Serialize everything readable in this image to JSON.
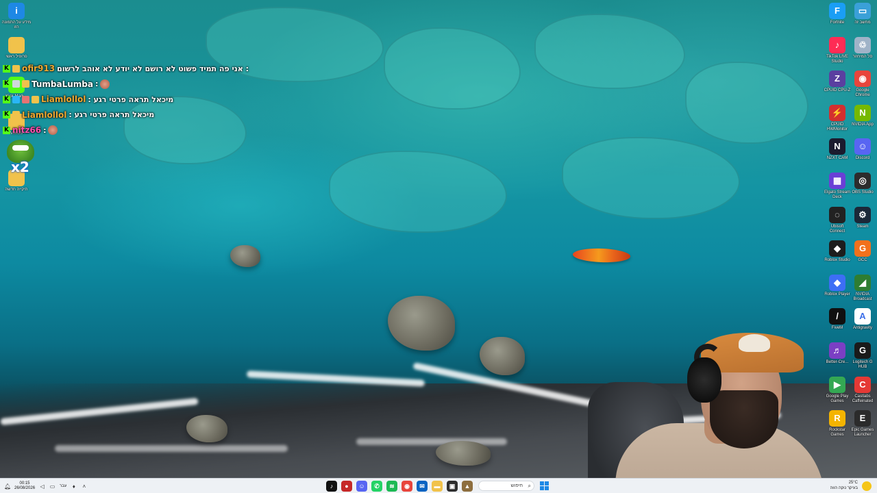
{
  "desktop_left": [
    {
      "label": "מידע על התמונה הזו",
      "icon": "info-icon",
      "color": "#1e88e5",
      "glyph": "i"
    },
    {
      "label": "פרופיל ראשי",
      "icon": "folder-icon",
      "color": "#f1c24b",
      "glyph": ""
    },
    {
      "label": "Kick-Mark...",
      "icon": "kick-marker-icon",
      "color": "#53fc18",
      "glyph": ""
    },
    {
      "label": "VIRUS",
      "icon": "virus-folder-icon",
      "color": "#f1c24b",
      "glyph": ""
    },
    {
      "label": "תיקייה חדשה",
      "icon": "new-folder-icon",
      "color": "#f1c24b",
      "glyph": ""
    }
  ],
  "desktop_right": [
    {
      "label": "Fortnite",
      "icon": "fortnite-icon",
      "color": "#1a9ef5",
      "glyph": "F"
    },
    {
      "label": "מחשב זה",
      "icon": "this-pc-icon",
      "color": "#3aa0d8",
      "glyph": "▭"
    },
    {
      "label": "TikTok LIVE Studio",
      "icon": "tiktok-live-icon",
      "color": "#fe2c55",
      "glyph": "♪"
    },
    {
      "label": "סל המיחזור",
      "icon": "recycle-bin-icon",
      "color": "#9fb3c8",
      "glyph": "♲"
    },
    {
      "label": "CPUID CPU-Z",
      "icon": "cpuz-icon",
      "color": "#5a3fa0",
      "glyph": "Z"
    },
    {
      "label": "Google Chrome",
      "icon": "chrome-icon",
      "color": "#e8453c",
      "glyph": "◉"
    },
    {
      "label": "CPUID HWMonitor",
      "icon": "hwmonitor-icon",
      "color": "#d32f2f",
      "glyph": "⚡"
    },
    {
      "label": "NVIDIA App",
      "icon": "nvidia-app-icon",
      "color": "#76b900",
      "glyph": "N"
    },
    {
      "label": "NZXT CAM",
      "icon": "nzxt-cam-icon",
      "color": "#1b1b2e",
      "glyph": "N"
    },
    {
      "label": "Discord",
      "icon": "discord-icon",
      "color": "#5865f2",
      "glyph": "☺"
    },
    {
      "label": "Elgato Stream Deck",
      "icon": "stream-deck-icon",
      "color": "#6a3fd6",
      "glyph": "▦"
    },
    {
      "label": "OBS Studio",
      "icon": "obs-icon",
      "color": "#2c2c2c",
      "glyph": "◎"
    },
    {
      "label": "Ubisoft Connect",
      "icon": "ubisoft-icon",
      "color": "#222222",
      "glyph": "◌"
    },
    {
      "label": "Steam",
      "icon": "steam-icon",
      "color": "#1b2838",
      "glyph": "⚙"
    },
    {
      "label": "Roblox Studio",
      "icon": "roblox-studio-icon",
      "color": "#1d1d1d",
      "glyph": "◆"
    },
    {
      "label": "GCC",
      "icon": "gcc-icon",
      "color": "#f2711c",
      "glyph": "G"
    },
    {
      "label": "Roblox Player",
      "icon": "roblox-player-icon",
      "color": "#3d6ef5",
      "glyph": "◆"
    },
    {
      "label": "NVIDIA Broadcast",
      "icon": "nvidia-broadcast-icon",
      "color": "#2e7d32",
      "glyph": "◢"
    },
    {
      "label": "FiveM",
      "icon": "fivem-icon",
      "color": "#101010",
      "glyph": "/"
    },
    {
      "label": "Antigravity",
      "icon": "antigravity-icon",
      "color": "#ffffff",
      "glyph": "A"
    },
    {
      "label": "Better-Cre...",
      "icon": "better-cre-icon",
      "color": "#7b3fc4",
      "glyph": "♬"
    },
    {
      "label": "Logitech G HUB",
      "icon": "logitech-ghub-icon",
      "color": "#1a1a1a",
      "glyph": "G"
    },
    {
      "label": "Google Play Games",
      "icon": "google-play-games-icon",
      "color": "#34a853",
      "glyph": "▶"
    },
    {
      "label": "Castlabs Caffeinated",
      "icon": "caffeinated-icon",
      "color": "#e53935",
      "glyph": "C"
    },
    {
      "label": "Rockstar Games",
      "icon": "rockstar-icon",
      "color": "#f4b400",
      "glyph": "R"
    },
    {
      "label": "Epic Games Launcher",
      "icon": "epic-games-icon",
      "color": "#2b2b2b",
      "glyph": "E"
    }
  ],
  "chat": [
    {
      "user": "ofir913",
      "message": "אני פה תמיד פשוט לא רושם לא יודע לא אוהב לרשום :",
      "user_color": "#f0a830",
      "badges": [
        "kick-badge",
        "subscriber-badge"
      ]
    },
    {
      "user": "TumbaLumba",
      "message": ":",
      "user_color": "#ffffff",
      "badges": [
        "kick-badge",
        "avatar-badge",
        "subscriber-badge"
      ],
      "emote": "emote-icon"
    },
    {
      "user": "Liamlollol",
      "message": ": מיכאל תראה פרטי רגע",
      "user_color": "#f0a830",
      "badges": [
        "kick-badge",
        "gem-badge",
        "shield-badge",
        "subscriber-badge"
      ]
    },
    {
      "user": "Liamlollol",
      "message": ": מיכאל תראה פרטי רגע",
      "user_color": "#f0a830",
      "badges": [
        "kick-badge",
        "subscriber-badge"
      ]
    },
    {
      "user": "nitz66",
      "message": ":",
      "user_color": "#ff4fae",
      "badges": [
        "kick-badge"
      ],
      "emote": "emote-icon"
    }
  ],
  "overlay": {
    "emote_label": "x2"
  },
  "taskbar": {
    "clock_time": "00:15",
    "clock_date": "26/08/2026",
    "language": "עבר",
    "search_placeholder": "חיפוש",
    "weather_temp": "25°C",
    "weather_desc": "בעיקר נוקה הווה",
    "apps": [
      {
        "name": "tiktok-icon",
        "color": "#111111",
        "glyph": "♪"
      },
      {
        "name": "red-app-icon",
        "color": "#c62828",
        "glyph": "●"
      },
      {
        "name": "discord-taskbar-icon",
        "color": "#5865f2",
        "glyph": "☺"
      },
      {
        "name": "whatsapp-icon",
        "color": "#25d366",
        "glyph": "✆"
      },
      {
        "name": "spotify-icon",
        "color": "#1db954",
        "glyph": "≋"
      },
      {
        "name": "chrome-taskbar-icon",
        "color": "#e8453c",
        "glyph": "◉"
      },
      {
        "name": "outlook-icon",
        "color": "#0a64c2",
        "glyph": "✉"
      },
      {
        "name": "file-explorer-icon",
        "color": "#f1c24b",
        "glyph": "▬"
      },
      {
        "name": "terminal-icon",
        "color": "#2d2d2d",
        "glyph": "▣"
      },
      {
        "name": "game-app-icon",
        "color": "#8d6e3f",
        "glyph": "▲"
      }
    ]
  }
}
